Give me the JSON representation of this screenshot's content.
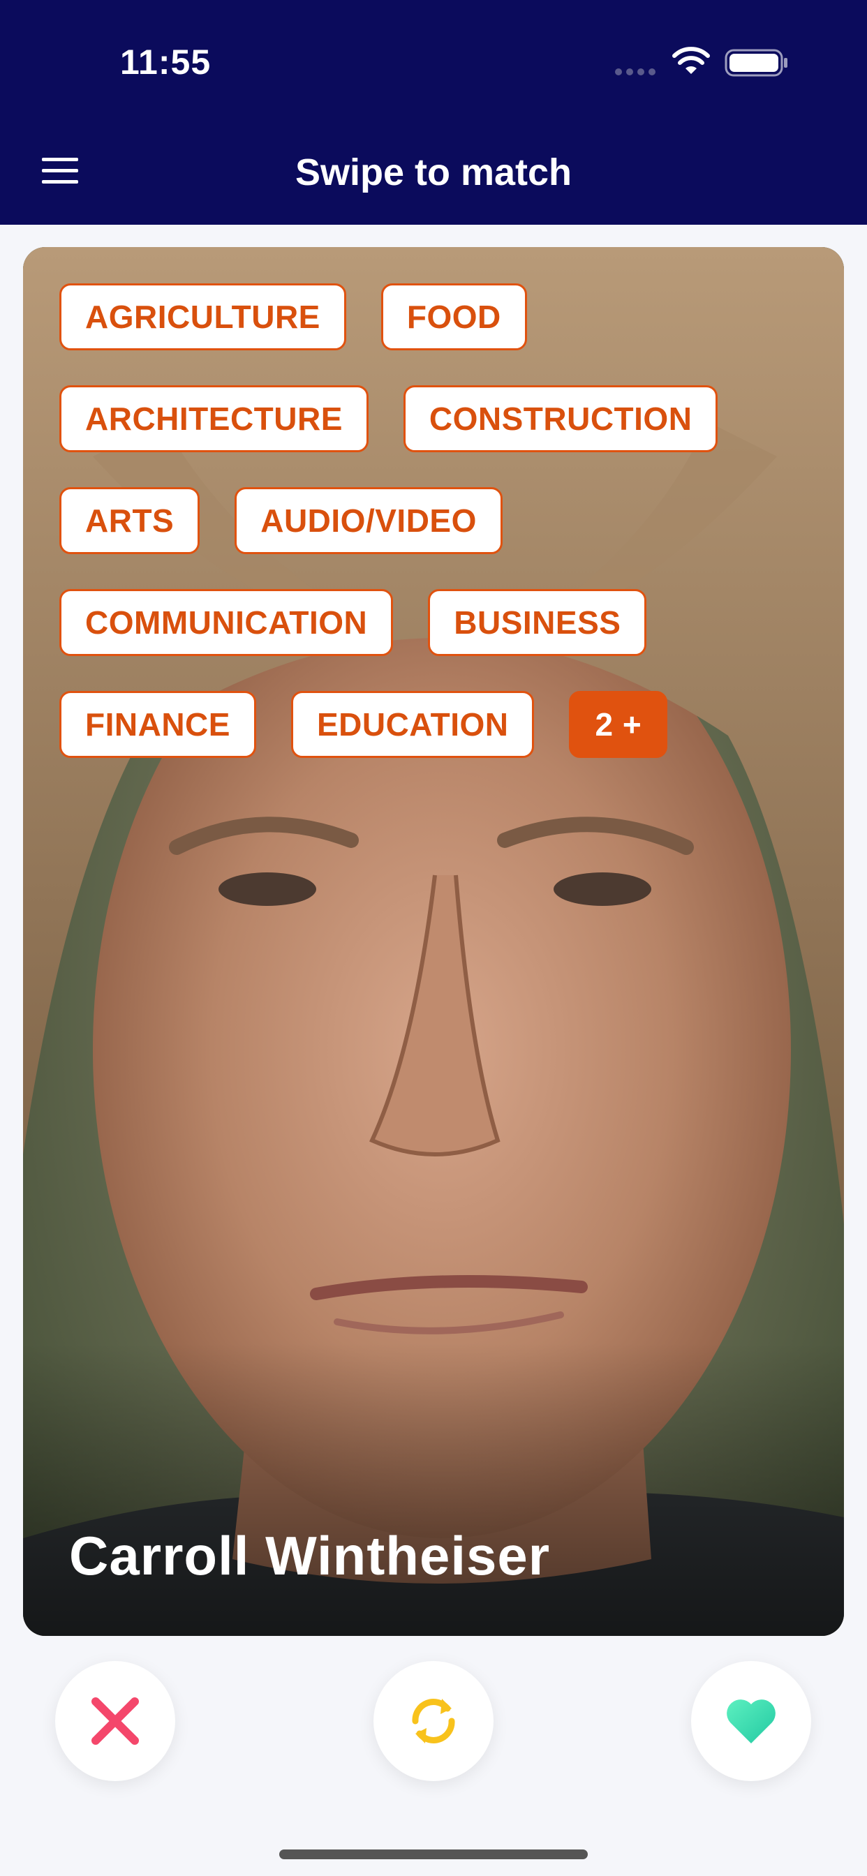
{
  "status_bar": {
    "time": "11:55",
    "icons": [
      "signal-icon",
      "wifi-icon",
      "battery-icon"
    ]
  },
  "nav": {
    "title": "Swipe to match",
    "menu_icon": "hamburger-menu-icon"
  },
  "card": {
    "name": "Carroll Wintheiser",
    "tag_rows": [
      [
        "AGRICULTURE",
        "FOOD"
      ],
      [
        "ARCHITECTURE",
        "CONSTRUCTION"
      ],
      [
        "ARTS",
        "AUDIO/VIDEO"
      ],
      [
        "COMMUNICATION",
        "BUSINESS"
      ],
      [
        "FINANCE",
        "EDUCATION"
      ]
    ],
    "more_tags": "2 +"
  },
  "actions": {
    "dislike_icon": "close-x-icon",
    "refresh_icon": "refresh-icon",
    "like_icon": "heart-icon"
  },
  "colors": {
    "nav_background": "#0b0b5c",
    "tag_accent": "#e0520f",
    "dislike": "#f4476b",
    "refresh": "#f8c21c",
    "like": "#3ee0b4"
  }
}
